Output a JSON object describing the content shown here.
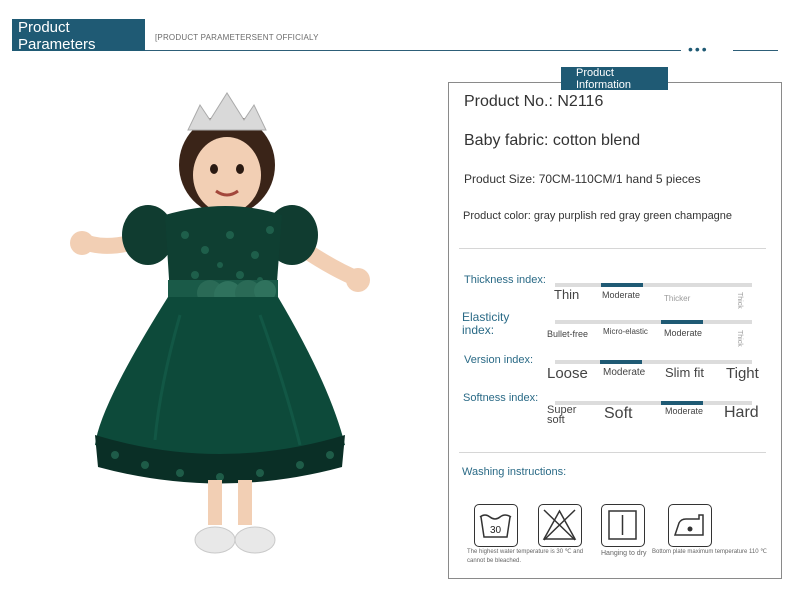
{
  "header": {
    "title_line1": "Product",
    "title_line2": "Parameters",
    "subtitle": "[PRODUCT PARAMETERSENT OFFICIALY",
    "dots": "•••"
  },
  "panel": {
    "tag_line1": "Product",
    "tag_line2": "Information",
    "product_no": "Product No.: N2116",
    "fabric": "Baby fabric: cotton blend",
    "size": "Product Size: 70CM-110CM/1 hand 5 pieces",
    "color": "Product color: gray purplish red gray green champagne"
  },
  "indexes": {
    "thickness": {
      "label": "Thickness index:",
      "value": 0.35,
      "options": [
        "Thin",
        "Moderate",
        "Thicker",
        "Thick"
      ]
    },
    "elasticity": {
      "label_line1": "Elasticity",
      "label_line2": "index:",
      "value": 0.6,
      "options": [
        "Bullet-free",
        "Micro-elastic",
        "Moderate",
        "Thick"
      ]
    },
    "version": {
      "label": "Version index:",
      "value": 0.35,
      "options": [
        "Loose",
        "Moderate",
        "Slim fit",
        "Tight"
      ]
    },
    "softness": {
      "label": "Softness index:",
      "value": 0.6,
      "options": [
        "Super",
        "soft",
        "Soft",
        "Moderate",
        "Hard"
      ]
    }
  },
  "washing": {
    "title": "Washing instructions:",
    "icons": [
      {
        "icon": "wash-tub-icon",
        "value": "30",
        "caption": "The highest water temperature is 30 ℃ and cannot be bleached."
      },
      {
        "icon": "no-bleach-icon",
        "caption": ""
      },
      {
        "icon": "hang-dry-icon",
        "caption": "Hanging to dry"
      },
      {
        "icon": "iron-icon",
        "caption": "Bottom plate maximum temperature 110 ℃"
      }
    ]
  },
  "colors": {
    "accent": "#1f5a74",
    "dress": "#0d4a3a",
    "label": "#2a6a86"
  }
}
